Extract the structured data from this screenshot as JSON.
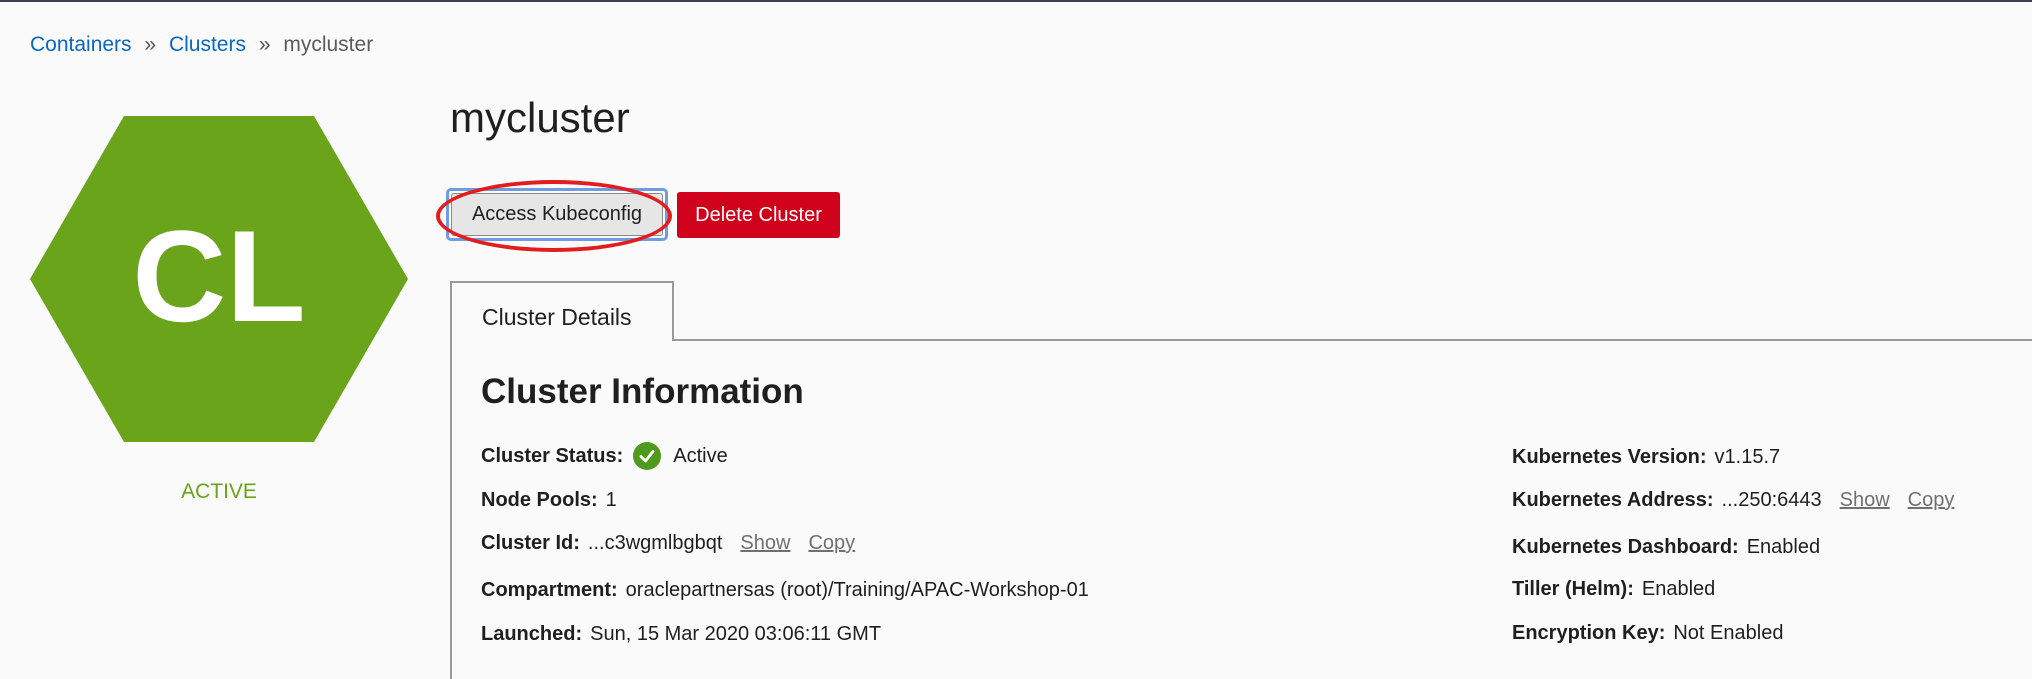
{
  "breadcrumb": {
    "items": [
      "Containers",
      "Clusters"
    ],
    "separator": "»",
    "current": "mycluster"
  },
  "badge": {
    "initials": "CL",
    "color": "#6aa41a",
    "status": "ACTIVE"
  },
  "header": {
    "title": "mycluster"
  },
  "actions": {
    "access_kubeconfig": "Access Kubeconfig",
    "delete_cluster": "Delete Cluster",
    "delete_color": "#d0021b"
  },
  "tabs": [
    {
      "label": "Cluster Details"
    }
  ],
  "info": {
    "heading": "Cluster Information",
    "status": {
      "label": "Cluster Status:",
      "value": "Active",
      "icon": "check-circle-icon"
    },
    "node_pools": {
      "label": "Node Pools:",
      "value": "1"
    },
    "cluster_id": {
      "label": "Cluster Id:",
      "value": "...c3wgmlbgbqt",
      "show": "Show",
      "copy": "Copy"
    },
    "compartment": {
      "label": "Compartment:",
      "value": "oraclepartnersas (root)/Training/APAC-Workshop-01"
    },
    "launched": {
      "label": "Launched:",
      "value": "Sun, 15 Mar 2020 03:06:11 GMT"
    },
    "k8s_version": {
      "label": "Kubernetes Version:",
      "value": "v1.15.7"
    },
    "k8s_address": {
      "label": "Kubernetes Address:",
      "value": "...250:6443",
      "show": "Show",
      "copy": "Copy"
    },
    "k8s_dashboard": {
      "label": "Kubernetes Dashboard:",
      "value": "Enabled"
    },
    "tiller": {
      "label": "Tiller (Helm):",
      "value": "Enabled"
    },
    "encryption": {
      "label": "Encryption Key:",
      "value": "Not Enabled"
    }
  }
}
